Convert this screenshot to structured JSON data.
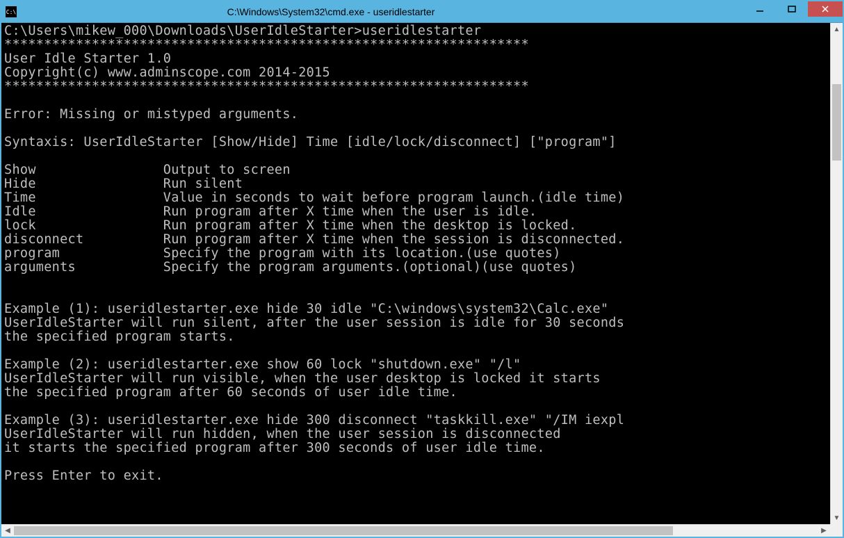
{
  "window": {
    "title": "C:\\Windows\\System32\\cmd.exe - useridlestarter",
    "icon_label": "C:\\"
  },
  "console": {
    "prompt": "C:\\Users\\mikew_000\\Downloads\\UserIdleStarter>useridlestarter",
    "divider": "******************************************************************",
    "app_name": "User Idle Starter 1.0",
    "copyright": "Copyright(c) www.adminscope.com 2014-2015",
    "error": "Error: Missing or mistyped arguments.",
    "syntaxis": "Syntaxis: UserIdleStarter [Show/Hide] Time [idle/lock/disconnect] [\"program\"]",
    "params": [
      {
        "name": "Show",
        "desc": "Output to screen"
      },
      {
        "name": "Hide",
        "desc": "Run silent"
      },
      {
        "name": "Time",
        "desc": "Value in seconds to wait before program launch.(idle time)"
      },
      {
        "name": "Idle",
        "desc": "Run program after X time when the user is idle."
      },
      {
        "name": "lock",
        "desc": "Run program after X time when the desktop is locked."
      },
      {
        "name": "disconnect",
        "desc": "Run program after X time when the session is disconnected."
      },
      {
        "name": "program",
        "desc": "Specify the program with its location.(use quotes)"
      },
      {
        "name": "arguments",
        "desc": "Specify the program arguments.(optional)(use quotes)"
      }
    ],
    "ex1_line1": "Example (1): useridlestarter.exe hide 30 idle \"C:\\windows\\system32\\Calc.exe\"",
    "ex1_line2": "UserIdleStarter will run silent, after the user session is idle for 30 seconds",
    "ex1_line3": "the specified program starts.",
    "ex2_line1": "Example (2): useridlestarter.exe show 60 lock \"shutdown.exe\" \"/l\"",
    "ex2_line2": "UserIdleStarter will run visible, when the user desktop is locked it starts",
    "ex2_line3": "the specified program after 60 seconds of user idle time.",
    "ex3_line1": "Example (3): useridlestarter.exe hide 300 disconnect \"taskkill.exe\" \"/IM iexpl",
    "ex3_line2": "UserIdleStarter will run hidden, when the user session is disconnected",
    "ex3_line3": "it starts the specified program after 300 seconds of user idle time.",
    "press_enter": "Press Enter to exit."
  }
}
